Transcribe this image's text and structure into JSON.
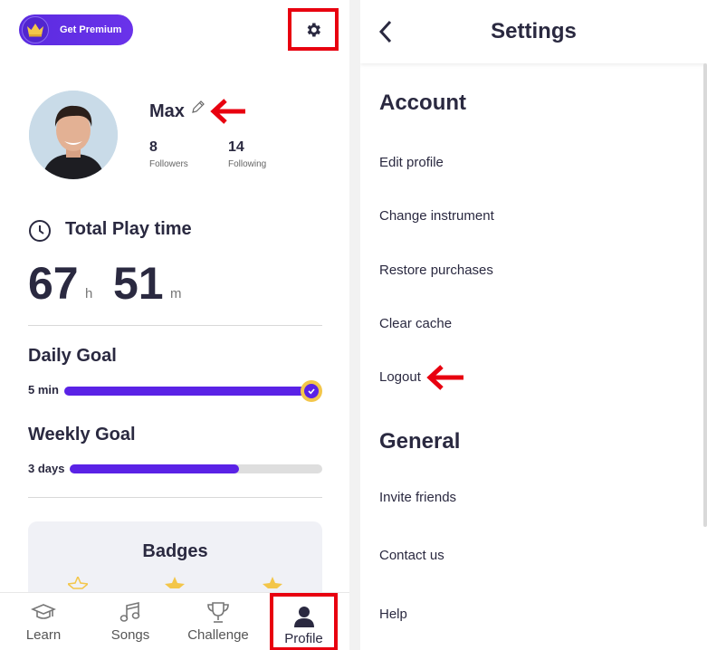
{
  "profile": {
    "premium_label": "Get Premium",
    "user_name": "Max",
    "followers_count": "8",
    "followers_label": "Followers",
    "following_count": "14",
    "following_label": "Following",
    "play_time_title": "Total Play time",
    "hours": "67",
    "hours_unit": "h",
    "minutes": "51",
    "minutes_unit": "m",
    "daily_goal_title": "Daily Goal",
    "daily_goal_value": "5 min",
    "daily_goal_progress": 1.0,
    "weekly_goal_title": "Weekly Goal",
    "weekly_goal_value": "3 days",
    "weekly_goal_progress": 0.67,
    "badges_title": "Badges"
  },
  "tabs": [
    {
      "label": "Learn",
      "icon": "graduation-cap-icon"
    },
    {
      "label": "Songs",
      "icon": "music-note-icon"
    },
    {
      "label": "Challenge",
      "icon": "trophy-icon"
    },
    {
      "label": "Profile",
      "icon": "person-icon",
      "active": true
    }
  ],
  "settings": {
    "title": "Settings",
    "account_section": "Account",
    "account_items": [
      "Edit profile",
      "Change instrument",
      "Restore purchases",
      "Clear cache",
      "Logout"
    ],
    "general_section": "General",
    "general_items": [
      "Invite friends",
      "Contact us",
      "Help"
    ]
  },
  "colors": {
    "accent": "#5a22e6",
    "highlight_red": "#e8000f",
    "star_gold": "#f3c64a"
  }
}
